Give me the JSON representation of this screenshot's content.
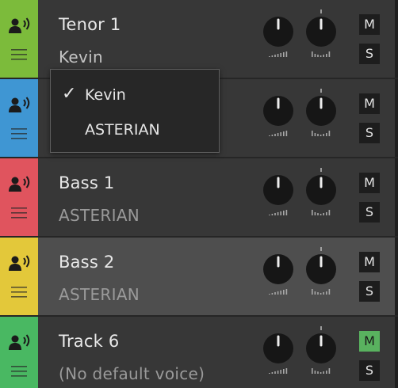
{
  "tracks": [
    {
      "name": "Tenor 1",
      "voice": "Kevin",
      "color": "#7cbb3b",
      "mute": false,
      "selected": false,
      "icons": {
        "singer": "speaker-person-icon",
        "menu": "hamburger-menu-icon"
      }
    },
    {
      "name": "",
      "voice": "",
      "color": "#3f96d3",
      "mute": false,
      "selected": false,
      "icons": {
        "singer": "speaker-person-icon",
        "menu": "hamburger-menu-icon"
      }
    },
    {
      "name": "Bass 1",
      "voice": "ASTERIAN",
      "color": "#e0545e",
      "mute": false,
      "selected": false,
      "icons": {
        "singer": "speaker-person-icon",
        "menu": "hamburger-menu-icon"
      }
    },
    {
      "name": "Bass 2",
      "voice": "ASTERIAN",
      "color": "#e3c83a",
      "mute": false,
      "selected": true,
      "icons": {
        "singer": "speaker-person-icon",
        "menu": "hamburger-menu-icon"
      }
    },
    {
      "name": "Track 6",
      "voice": "(No default voice)",
      "color": "#49b862",
      "mute": true,
      "selected": false,
      "icons": {
        "singer": "speaker-person-icon",
        "menu": "hamburger-menu-icon"
      }
    }
  ],
  "buttons": {
    "mute_label": "M",
    "solo_label": "S"
  },
  "knob_icons": {
    "volume": "volume-bars-icon",
    "pan": "pan-bars-icon"
  },
  "colors": {
    "mute_active": "#59b25f",
    "panel": "#373737",
    "panel_selected": "#4e4e4e"
  },
  "dropdown": {
    "options": [
      {
        "label": "Kevin",
        "checked": true,
        "check_mark": "✓"
      },
      {
        "label": "ASTERIAN",
        "checked": false,
        "check_mark": ""
      }
    ]
  }
}
